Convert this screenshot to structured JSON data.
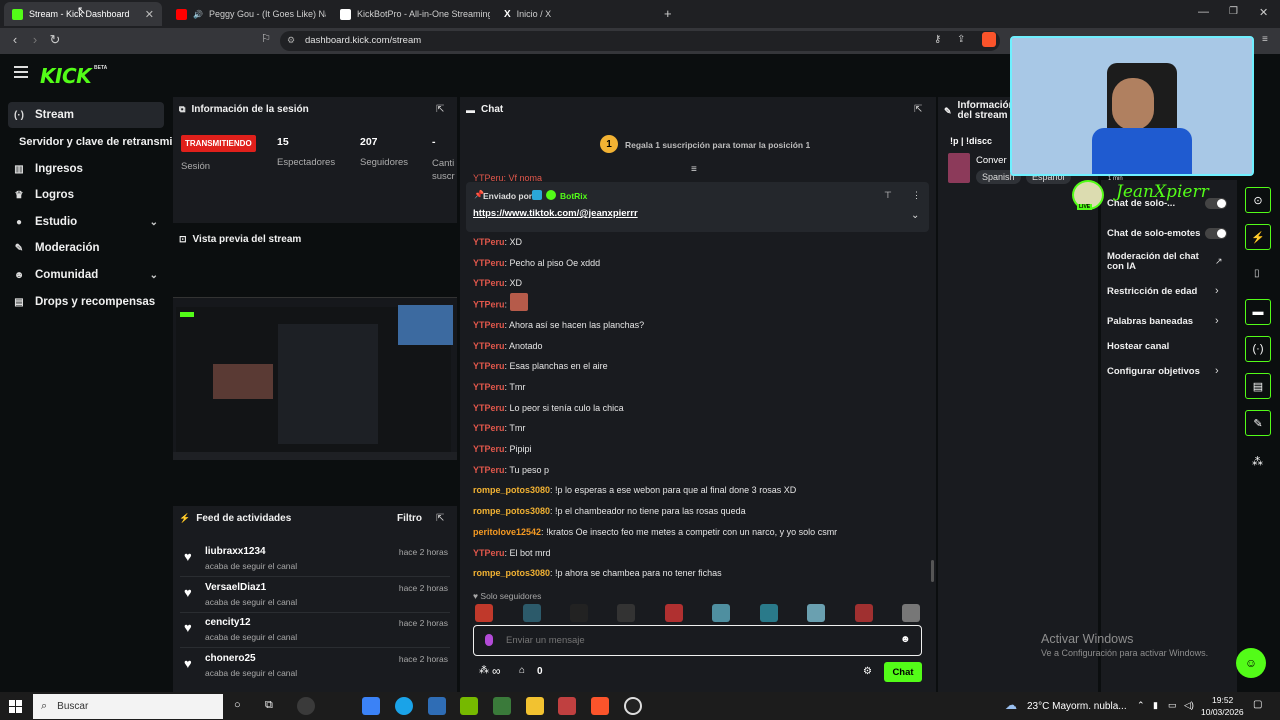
{
  "browser": {
    "tabs": [
      {
        "label": "Stream - Kick Dashboard",
        "color": "#53fc18"
      },
      {
        "label": "Peggy Gou - (It Goes Like) NaNa",
        "color": "#ff0000"
      },
      {
        "label": "KickBotPro - All-in-One Streaming To",
        "color": "#ffffff"
      },
      {
        "label": "Inicio / X",
        "color": "#000000"
      }
    ],
    "url": "dashboard.kick.com/stream"
  },
  "brand": {
    "logo": "KICK",
    "beta": "BETA",
    "accent": "#53fc18"
  },
  "sidebar": {
    "items": [
      {
        "label": "Stream",
        "icon": "broadcast-icon",
        "glyph": "(·)"
      },
      {
        "label": "Servidor y clave de retransmisión",
        "icon": "",
        "glyph": ""
      },
      {
        "label": "Ingresos",
        "icon": "chart-icon",
        "glyph": "▥"
      },
      {
        "label": "Logros",
        "icon": "trophy-icon",
        "glyph": "🏆"
      },
      {
        "label": "Estudio",
        "icon": "palette-icon",
        "glyph": "●"
      },
      {
        "label": "Moderación",
        "icon": "wrench-icon",
        "glyph": "✎"
      },
      {
        "label": "Comunidad",
        "icon": "people-icon",
        "glyph": "☻"
      },
      {
        "label": "Drops y recompensas",
        "icon": "gift-icon",
        "glyph": "▤"
      }
    ]
  },
  "session": {
    "title": "Información de la sesión",
    "badge": "TRANSMITIENDO",
    "session_label": "Sesión",
    "viewers": "15",
    "viewers_label": "Espectadores",
    "followers": "207",
    "followers_label": "Seguidores",
    "subs": "-",
    "subs_label": "Canti suscr"
  },
  "preview": {
    "title": "Vista previa del stream"
  },
  "feed": {
    "title": "Feed de actividades",
    "filter": "Filtro",
    "items": [
      {
        "user": "liubraxx1234",
        "action": "acaba de seguir el canal",
        "time": "hace 2 horas"
      },
      {
        "user": "VersaelDiaz1",
        "action": "acaba de seguir el canal",
        "time": "hace 2 horas"
      },
      {
        "user": "cencity12",
        "action": "acaba de seguir el canal",
        "time": "hace 2 horas"
      },
      {
        "user": "chonero25",
        "action": "acaba de seguir el canal",
        "time": "hace 2 horas"
      }
    ]
  },
  "chat": {
    "title": "Chat",
    "gift_rank": "1",
    "gift_text": "Regala 1 suscripción para tomar la posición 1",
    "partial_top": "YTPeru: Vf noma",
    "pinned_by": "Enviado por",
    "pinned_bot": "BotRix",
    "pinned_link": "https://www.tiktok.com/@jeanxpierrr",
    "messages": [
      {
        "user": "YTPeru",
        "text": "XD",
        "color": "red"
      },
      {
        "user": "YTPeru",
        "text": "Pecho al piso Oe xddd",
        "color": "red"
      },
      {
        "user": "YTPeru",
        "text": "XD",
        "color": "red"
      },
      {
        "user": "YTPeru",
        "text": "",
        "color": "red"
      },
      {
        "user": "YTPeru",
        "text": "Ahora así se hacen las planchas?",
        "color": "red"
      },
      {
        "user": "YTPeru",
        "text": "Anotado",
        "color": "red"
      },
      {
        "user": "YTPeru",
        "text": "Esas planchas en el aire",
        "color": "red"
      },
      {
        "user": "YTPeru",
        "text": "Tmr",
        "color": "red"
      },
      {
        "user": "YTPeru",
        "text": "Lo peor si tenía culo la chica",
        "color": "red"
      },
      {
        "user": "YTPeru",
        "text": "Tmr",
        "color": "red"
      },
      {
        "user": "YTPeru",
        "text": "Pipipi",
        "color": "red"
      },
      {
        "user": "YTPeru",
        "text": "Tu peso p",
        "color": "red"
      },
      {
        "user": "rompe_potos3080",
        "text": "!p lo esperas a ese webon para que al final done 3 rosas XD",
        "color": "yel"
      },
      {
        "user": "rompe_potos3080",
        "text": "!p el chambeador no tiene para las rosas queda",
        "color": "yel"
      },
      {
        "user": "peritolove12542",
        "text": "!kratos Oe insecto feo me metes a competir con un narco, y yo solo csmr",
        "color": "or"
      },
      {
        "user": "YTPeru",
        "text": "El bot mrd",
        "color": "red"
      },
      {
        "user": "rompe_potos3080",
        "text": "!p ahora se chambea para no tener fichas",
        "color": "yel"
      }
    ],
    "followers_only": "Solo seguidores",
    "input_placeholder": "Enviar un mensaje",
    "points": "∞",
    "count": "0",
    "send": "Chat"
  },
  "right": {
    "title": "Información del stream",
    "line1": "!p | !discc",
    "category": "Conver",
    "tags": [
      "Spanish",
      "Español"
    ],
    "options": [
      {
        "label": "Chat de solo-...",
        "kind": "toggle"
      },
      {
        "label": "Chat de solo-emotes",
        "kind": "toggle"
      },
      {
        "label": "Moderación del chat con IA",
        "kind": "link"
      },
      {
        "label": "Restricción de edad",
        "kind": "chevron"
      },
      {
        "label": "Palabras baneadas",
        "kind": "chevron"
      },
      {
        "label": "Hostear canal",
        "kind": "none"
      },
      {
        "label": "Configurar objetivos",
        "kind": "chevron"
      }
    ]
  },
  "overlay": {
    "name": "JeanXpierr",
    "live": "LIVE",
    "time": "1 min"
  },
  "watermark": {
    "title": "Activar Windows",
    "sub": "Ve a Configuración para activar Windows."
  },
  "taskbar": {
    "search": "Buscar",
    "weather": "23°C  Mayorm. nubla...",
    "time": "19:52",
    "date": "10/03/2026"
  }
}
